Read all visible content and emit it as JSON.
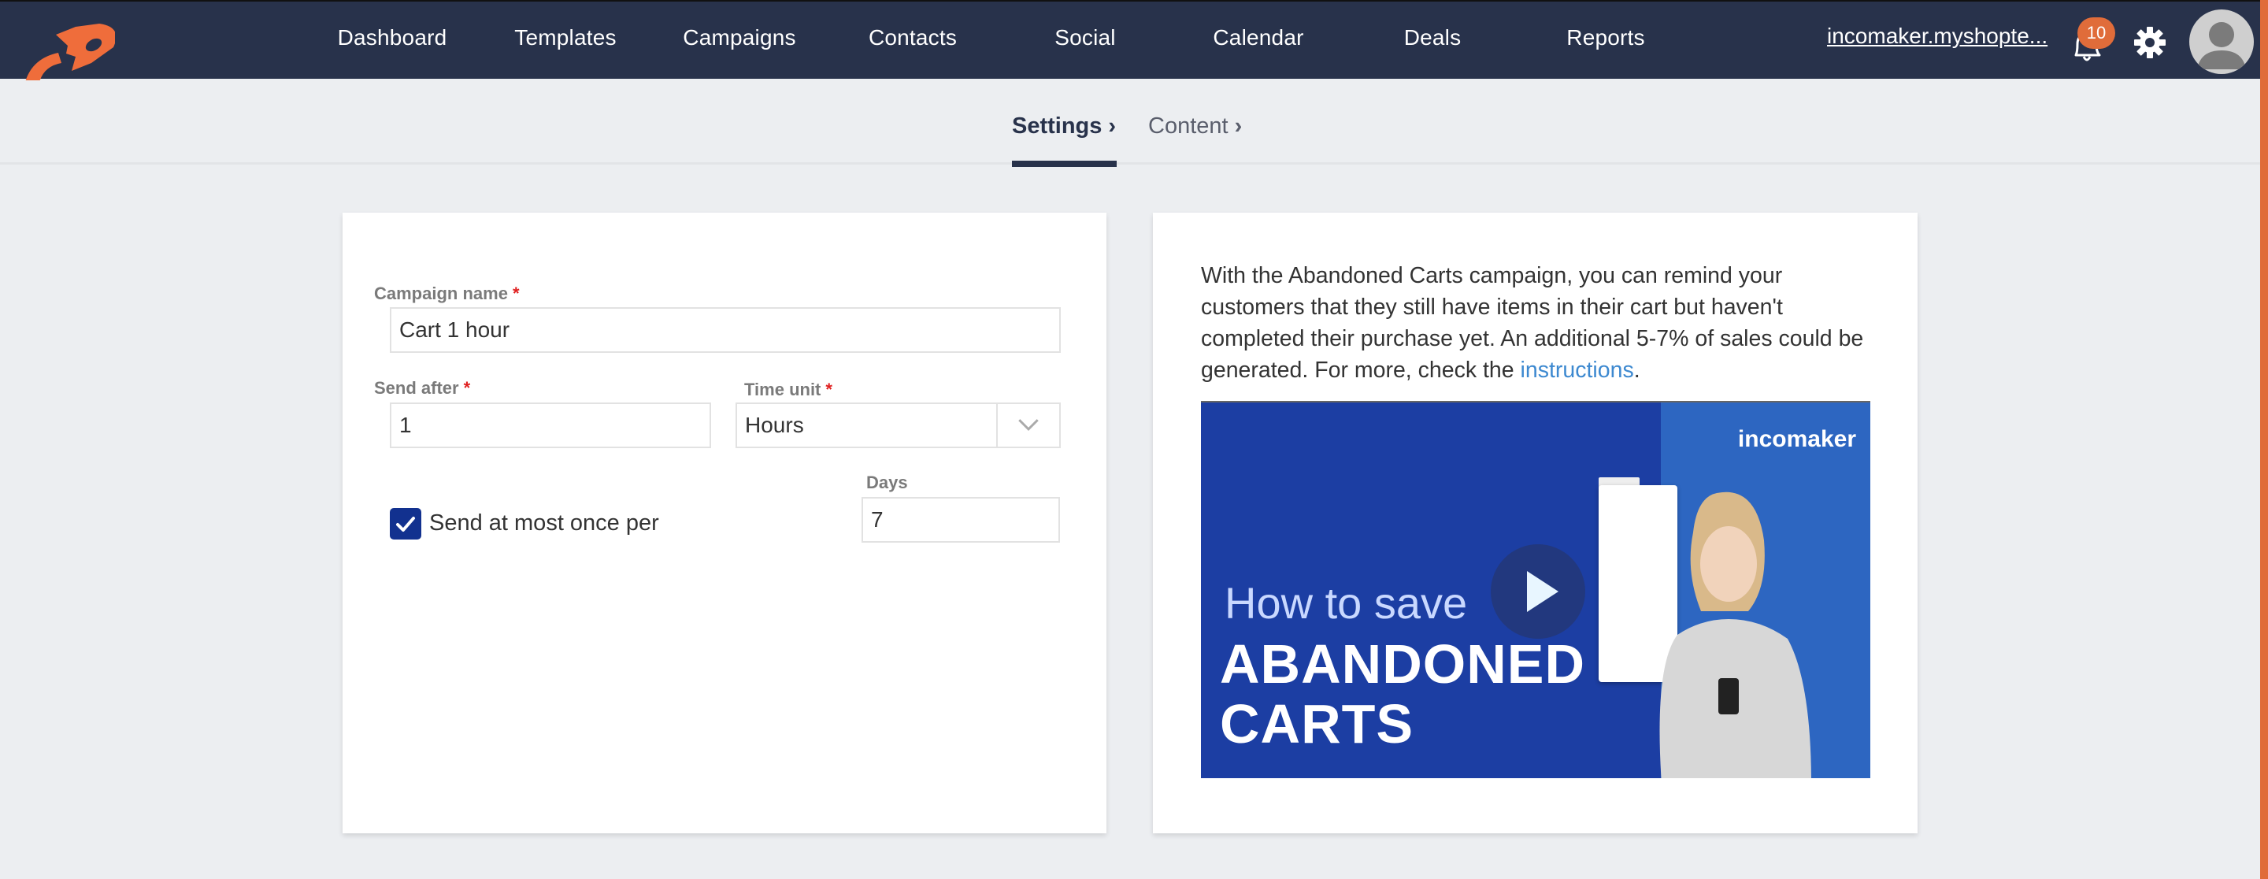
{
  "app": {
    "brand_color": "#e06c3a",
    "navbar_color": "#28324b"
  },
  "navbar": {
    "items": [
      {
        "label": "Dashboard"
      },
      {
        "label": "Templates"
      },
      {
        "label": "Campaigns"
      },
      {
        "label": "Contacts"
      },
      {
        "label": "Social"
      },
      {
        "label": "Calendar"
      },
      {
        "label": "Deals"
      },
      {
        "label": "Reports"
      }
    ],
    "account_label": "incomaker.myshopte...",
    "notifications_count": "10",
    "icons": {
      "logo": "rocket-logo-icon",
      "notifications": "bell-icon",
      "settings": "gear-icon",
      "profile": "user-avatar-icon"
    }
  },
  "tabs": [
    {
      "label": "Settings",
      "chevron": "›",
      "active": true
    },
    {
      "label": "Content",
      "chevron": "›",
      "active": false
    }
  ],
  "form": {
    "campaign_name": {
      "label": "Campaign name",
      "required_mark": "*",
      "value": "Cart 1 hour"
    },
    "send_after": {
      "label": "Send after",
      "required_mark": "*",
      "value": "1"
    },
    "time_unit": {
      "label": "Time unit",
      "required_mark": "*",
      "value": "Hours"
    },
    "send_once": {
      "label": "Send at most once per",
      "checked": true
    },
    "days": {
      "label": "Days",
      "value": "7"
    }
  },
  "info": {
    "text": "With the Abandoned Carts campaign, you can remind your customers that they still have items in their cart but haven't completed their purchase yet. An additional 5-7% of sales could be generated. For more, check the ",
    "link_label": "instructions",
    "text_end": "."
  },
  "video": {
    "brand": "incomaker",
    "line1": "How to save",
    "line2": "ABANDONED",
    "line3": "CARTS",
    "play_icon": "play-icon"
  }
}
